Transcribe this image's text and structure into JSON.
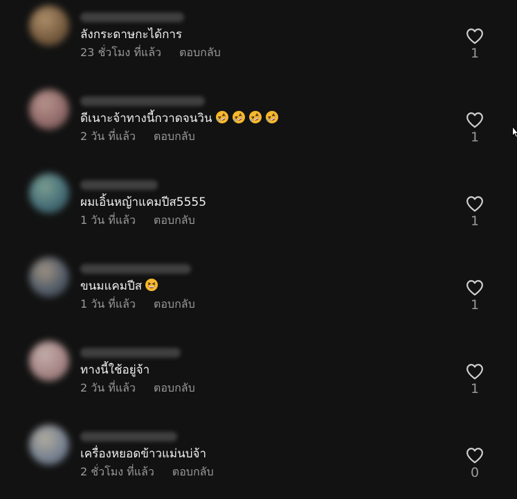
{
  "comments": [
    {
      "text": "ลังกระดาษกะได้การ",
      "time": "23 ชั่วโมง ที่แล้ว",
      "reply_label": "ตอบกลับ",
      "like_count": "1",
      "emoji": [],
      "avatar_colors": [
        "#8a6a48",
        "#c9a57a",
        "#5b4634"
      ]
    },
    {
      "text": "ดีเนาะจ้าทางนี้กวาดจนวิน",
      "time": "2 วัน ที่แล้ว",
      "reply_label": "ตอบกลับ",
      "like_count": "1",
      "emoji": [
        "rolling-on-floor-laughing-emoji",
        "rolling-on-floor-laughing-emoji",
        "rolling-on-floor-laughing-emoji",
        "rolling-on-floor-laughing-emoji"
      ],
      "avatar_colors": [
        "#a87c7a",
        "#d4aaa3",
        "#6e5052"
      ]
    },
    {
      "text": "ผมเอิ้นหญ้าแคมปีส5555",
      "time": "1 วัน ที่แล้ว",
      "reply_label": "ตอบกลับ",
      "like_count": "1",
      "emoji": [],
      "avatar_colors": [
        "#4f7f8a",
        "#8fb6a6",
        "#2f4a50"
      ]
    },
    {
      "text": "ขนมแคมปีส",
      "time": "1 วัน ที่แล้ว",
      "reply_label": "ตอบกลับ",
      "like_count": "1",
      "emoji": [
        "grinning-squinting-face-emoji"
      ],
      "avatar_colors": [
        "#5e6a78",
        "#b9a996",
        "#3a3f47"
      ]
    },
    {
      "text": "ทางนี้ใช้อยู่จ้า",
      "time": "2 วัน ที่แล้ว",
      "reply_label": "ตอบกลับ",
      "like_count": "1",
      "emoji": [],
      "avatar_colors": [
        "#c09a9a",
        "#e2c9c4",
        "#8a6c6c"
      ]
    },
    {
      "text": "เครื่องหยอดข้าวแม่นบ่จ้า",
      "time": "2 ชั่วโมง ที่แล้ว",
      "reply_label": "ตอบกลับ",
      "like_count": "0",
      "emoji": [],
      "avatar_colors": [
        "#8a97a8",
        "#cfc6b8",
        "#5a6272"
      ]
    }
  ],
  "colors": {
    "background": "#121212",
    "text": "#f1f1f1",
    "secondary_text": "#9a9a9a",
    "heart_outline": "#d0d0d0"
  }
}
